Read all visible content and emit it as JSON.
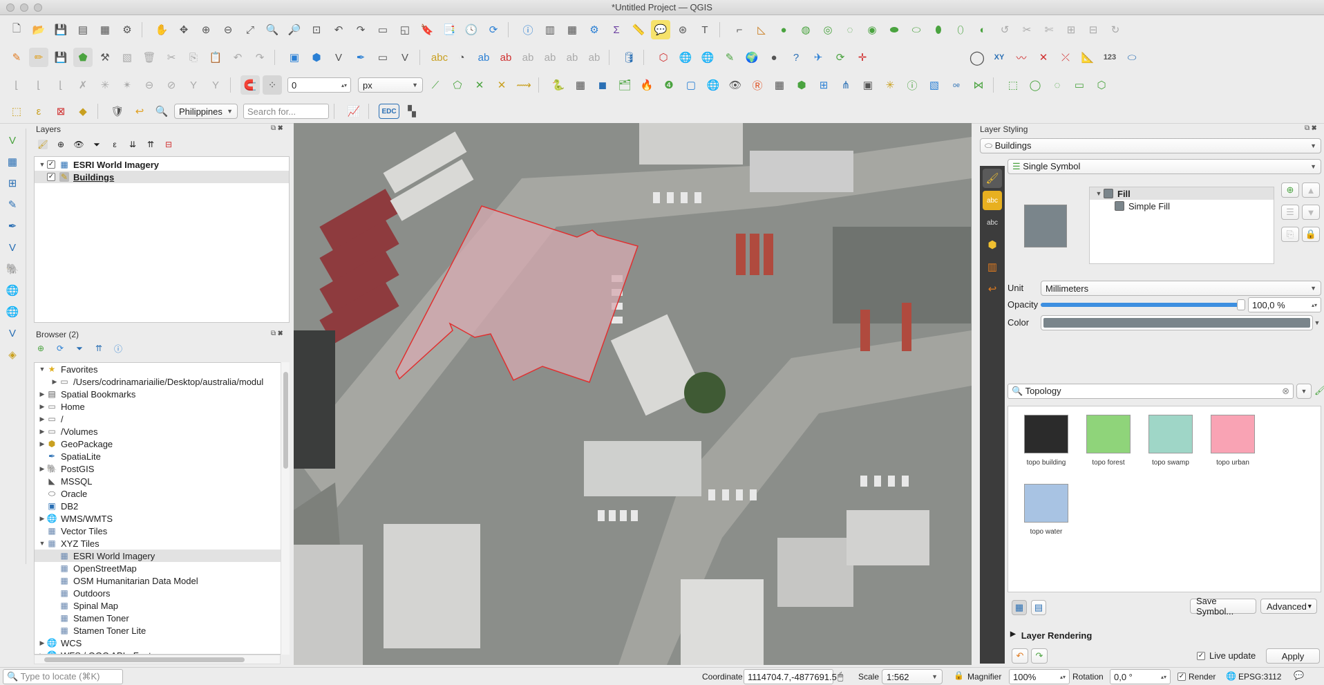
{
  "window": {
    "title": "*Untitled Project — QGIS"
  },
  "toolbar": {
    "snap_tolerance_value": "0",
    "snap_unit": "px",
    "locator_country": "Philippines",
    "search_placeholder": "Search for...",
    "edc_label": "EDC",
    "xy_label": "XY",
    "num_label": "123"
  },
  "layers_panel": {
    "title": "Layers",
    "layers": [
      {
        "name": "ESRI World Imagery",
        "checked": true
      },
      {
        "name": "Buildings",
        "checked": true
      }
    ]
  },
  "browser_panel": {
    "title": "Browser (2)",
    "items": [
      {
        "label": "Favorites",
        "expanded": true,
        "indent": 0,
        "icon": "star-icon"
      },
      {
        "label": "/Users/codrinamariailie/Desktop/australia/modul",
        "indent": 1,
        "icon": "folder-icon"
      },
      {
        "label": "Spatial Bookmarks",
        "indent": 0,
        "icon": "bookmark-icon"
      },
      {
        "label": "Home",
        "indent": 0,
        "icon": "folder-icon"
      },
      {
        "label": "/",
        "indent": 0,
        "icon": "folder-icon"
      },
      {
        "label": "/Volumes",
        "indent": 0,
        "icon": "folder-icon"
      },
      {
        "label": "GeoPackage",
        "indent": 0,
        "icon": "geopackage-icon"
      },
      {
        "label": "SpatiaLite",
        "indent": 0,
        "icon": "spatialite-icon"
      },
      {
        "label": "PostGIS",
        "indent": 0,
        "icon": "postgis-icon"
      },
      {
        "label": "MSSQL",
        "indent": 0,
        "icon": "mssql-icon"
      },
      {
        "label": "Oracle",
        "indent": 0,
        "icon": "oracle-icon"
      },
      {
        "label": "DB2",
        "indent": 0,
        "icon": "db2-icon"
      },
      {
        "label": "WMS/WMTS",
        "indent": 0,
        "icon": "globe-icon"
      },
      {
        "label": "Vector Tiles",
        "indent": 0,
        "icon": "grid-icon"
      },
      {
        "label": "XYZ Tiles",
        "expanded": true,
        "indent": 0,
        "icon": "grid-icon"
      },
      {
        "label": "ESRI World Imagery",
        "indent": 1,
        "icon": "grid-icon",
        "selected": true
      },
      {
        "label": "OpenStreetMap",
        "indent": 1,
        "icon": "grid-icon"
      },
      {
        "label": "OSM Humanitarian Data Model",
        "indent": 1,
        "icon": "grid-icon"
      },
      {
        "label": "Outdoors",
        "indent": 1,
        "icon": "grid-icon"
      },
      {
        "label": "Spinal Map",
        "indent": 1,
        "icon": "grid-icon"
      },
      {
        "label": "Stamen Toner",
        "indent": 1,
        "icon": "grid-icon"
      },
      {
        "label": "Stamen Toner Lite",
        "indent": 1,
        "icon": "grid-icon"
      },
      {
        "label": "WCS",
        "indent": 0,
        "icon": "globe-icon"
      },
      {
        "label": "WFS / OGC API - Features",
        "indent": 0,
        "icon": "globe-icon"
      }
    ]
  },
  "layer_styling": {
    "title": "Layer Styling",
    "layer": "Buildings",
    "renderer": "Single Symbol",
    "symbol_tree": {
      "root": "Fill",
      "child": "Simple Fill"
    },
    "unit_label": "Unit",
    "unit_value": "Millimeters",
    "opacity_label": "Opacity",
    "opacity_value": "100,0 %",
    "opacity_fraction": 1.0,
    "color_label": "Color",
    "symbol_color": "#7a858b",
    "library_search": "Topology",
    "library": [
      {
        "name": "topo building",
        "color": "#2b2b2b"
      },
      {
        "name": "topo forest",
        "color": "#8fd47a"
      },
      {
        "name": "topo swamp",
        "color": "#9fd6c7"
      },
      {
        "name": "topo urban",
        "color": "#f9a3b4"
      },
      {
        "name": "topo water",
        "color": "#a8c3e3"
      }
    ],
    "save_symbol": "Save Symbol...",
    "advanced": "Advanced",
    "layer_rendering": "Layer Rendering",
    "live_update": "Live update",
    "apply": "Apply"
  },
  "statusbar": {
    "locate_placeholder": "Type to locate (⌘K)",
    "coordinate_label": "Coordinate",
    "coordinate_value": "1114704.7,-4877691.5",
    "scale_label": "Scale",
    "scale_value": "1:562",
    "magnifier_label": "Magnifier",
    "magnifier_value": "100%",
    "rotation_label": "Rotation",
    "rotation_value": "0,0 °",
    "render_label": "Render",
    "crs": "EPSG:3112"
  }
}
